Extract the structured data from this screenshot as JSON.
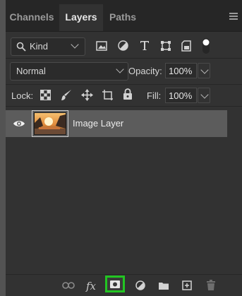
{
  "tabs": [
    {
      "label": "Channels",
      "active": false
    },
    {
      "label": "Layers",
      "active": true
    },
    {
      "label": "Paths",
      "active": false
    }
  ],
  "filter": {
    "kind_label": "Kind",
    "icons": [
      "image-filter-icon",
      "adjustment-filter-icon",
      "type-filter-icon",
      "shape-filter-icon",
      "smart-object-filter-icon",
      "filter-toggle-icon"
    ]
  },
  "blend": {
    "mode": "Normal",
    "opacity_label": "Opacity:",
    "opacity_value": "100%"
  },
  "lock": {
    "label": "Lock:",
    "icons": [
      "lock-transparent-pixels-icon",
      "lock-image-pixels-icon",
      "lock-position-icon",
      "lock-artboard-icon",
      "lock-all-icon"
    ],
    "fill_label": "Fill:",
    "fill_value": "100%"
  },
  "layers": [
    {
      "name": "Image Layer",
      "visible": true,
      "selected": true
    }
  ],
  "bottom_toolbar": {
    "fx_label": "fx",
    "icons": [
      "link-layers-icon",
      "layer-style-icon",
      "add-mask-icon",
      "adjustment-layer-icon",
      "new-group-icon",
      "new-layer-icon",
      "delete-layer-icon"
    ],
    "highlighted": "add-mask-icon",
    "highlight_color": "#22c522"
  }
}
